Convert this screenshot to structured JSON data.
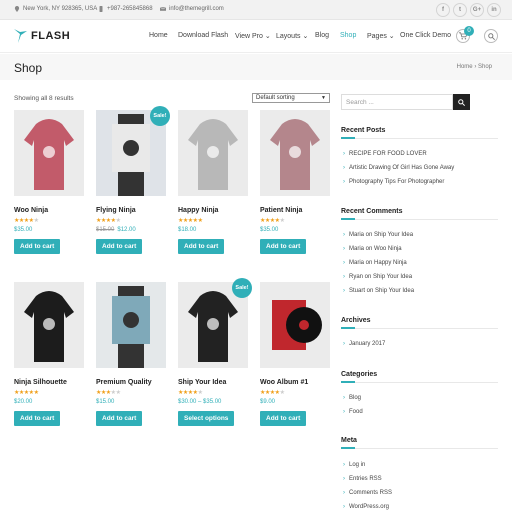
{
  "topbar": {
    "address": "New York, NY 928365, USA",
    "phone": "+987-265845868",
    "email": "info@themegrill.com",
    "social": [
      "f",
      "t",
      "G+",
      "in"
    ]
  },
  "header": {
    "logo": "FLASH",
    "nav": [
      "Home",
      "Download Flash",
      "View Pro",
      "Layouts",
      "Blog",
      "Shop",
      "Pages",
      "One Click Demo"
    ],
    "cart_count": "0"
  },
  "page": {
    "title": "Shop",
    "breadcrumb_home": "Home",
    "breadcrumb_sep": "›",
    "breadcrumb_current": "Shop"
  },
  "shop": {
    "results": "Showing all 8 results",
    "sorting": "Default sorting",
    "sale_label": "Sale!",
    "products": [
      {
        "name": "Woo Ninja",
        "price": "$35.00",
        "old_price": "",
        "stars": 4,
        "button": "Add to cart",
        "sale": false,
        "colors": [
          "#c25b6a",
          "#ebebeb"
        ]
      },
      {
        "name": "Flying Ninja",
        "price": "$12.00",
        "old_price": "$15.00",
        "stars": 4,
        "button": "Add to cart",
        "sale": true,
        "colors": [
          "#e9e9e9",
          "#dfe3e8"
        ]
      },
      {
        "name": "Happy Ninja",
        "price": "$18.00",
        "old_price": "",
        "stars": 5,
        "button": "Add to cart",
        "sale": false,
        "colors": [
          "#b8b8b8",
          "#ebebeb"
        ]
      },
      {
        "name": "Patient Ninja",
        "price": "$35.00",
        "old_price": "",
        "stars": 4,
        "button": "Add to cart",
        "sale": false,
        "colors": [
          "#b4868c",
          "#ebebeb"
        ]
      },
      {
        "name": "Ninja Silhouette",
        "price": "$20.00",
        "old_price": "",
        "stars": 5,
        "button": "Add to cart",
        "sale": false,
        "colors": [
          "#1c1c1c",
          "#ebebeb"
        ]
      },
      {
        "name": "Premium Quality",
        "price": "$15.00",
        "old_price": "",
        "stars": 3,
        "button": "Add to cart",
        "sale": false,
        "colors": [
          "#7fa9b9",
          "#e4e8ea"
        ]
      },
      {
        "name": "Ship Your Idea",
        "price": "$30.00 – $35.00",
        "old_price": "",
        "stars": 4,
        "button": "Select options",
        "sale": true,
        "colors": [
          "#222222",
          "#ebebeb"
        ]
      },
      {
        "name": "Woo Album #1",
        "price": "$9.00",
        "old_price": "",
        "stars": 4,
        "button": "Add to cart",
        "sale": false,
        "colors": [
          "#c0272d",
          "#ebebeb"
        ]
      }
    ]
  },
  "sidebar": {
    "search_placeholder": "Search ...",
    "recent_posts_title": "Recent Posts",
    "recent_posts": [
      "RECIPE FOR FOOD LOVER",
      "Artistic Drawing Of Girl Has Gone Away",
      "Photography Tips For Photographer"
    ],
    "recent_comments_title": "Recent Comments",
    "recent_comments": [
      {
        "author": "Maria",
        "on": "on",
        "post": "Ship Your Idea"
      },
      {
        "author": "Maria",
        "on": "on",
        "post": "Woo Ninja"
      },
      {
        "author": "Maria",
        "on": "on",
        "post": "Happy Ninja"
      },
      {
        "author": "Ryan",
        "on": "on",
        "post": "Ship Your Idea"
      },
      {
        "author": "Stuart",
        "on": "on",
        "post": "Ship Your Idea"
      }
    ],
    "archives_title": "Archives",
    "archives": [
      "January 2017"
    ],
    "categories_title": "Categories",
    "categories": [
      "Blog",
      "Food"
    ],
    "meta_title": "Meta",
    "meta": [
      "Log in",
      "Entries RSS",
      "Comments RSS",
      "WordPress.org"
    ]
  },
  "colors": {
    "accent": "#30afb8",
    "star": "#f0a01c"
  }
}
